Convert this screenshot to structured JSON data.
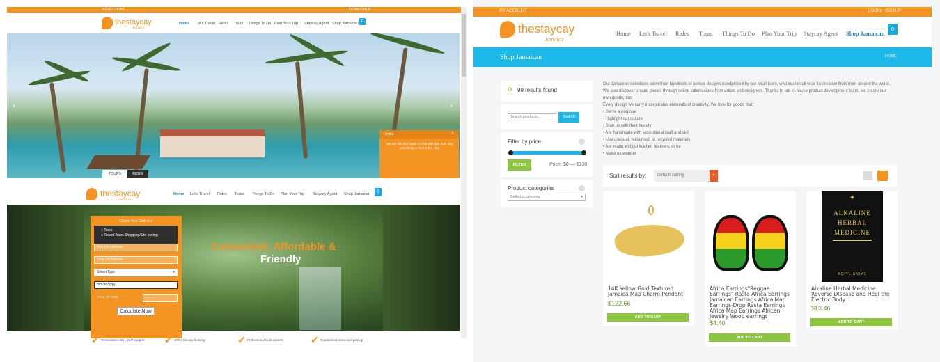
{
  "left_site": {
    "topbar": {
      "my_account": "MY ACCOUNT",
      "login": "LOGIN",
      "signup": "SIGNUP"
    },
    "logo": {
      "name": "thestaycay",
      "sub": "Jamaica"
    },
    "nav": [
      {
        "label": "Home"
      },
      {
        "label": "Let's Travel"
      },
      {
        "label": "Rides"
      },
      {
        "label": "Tours"
      },
      {
        "label": "Things To Do"
      },
      {
        "label": "Plan Your Trip"
      },
      {
        "label": "Staycay Agent"
      },
      {
        "label": "Shop Jamaican"
      }
    ],
    "cart_count": "0",
    "slider": {
      "prev": "‹",
      "next": "›",
      "tab1": "TOURS",
      "tab2": "RIDES"
    },
    "chat": {
      "title": "Online",
      "message": "We are live and ready to chat with you now. Say something to start a live chat."
    },
    "hero_title_line1": "Convenient, Affordable &",
    "hero_title_line2": "Friendly",
    "form": {
      "title": "Create Your Own tour",
      "radio1": "Tours",
      "radio2": "Round Tours Shopping/Site-seeing",
      "pickup_placeholder": "Pick Up Address",
      "dropoff_placeholder": "Drop Off Address",
      "select_type": "Select Type",
      "date_placeholder": "mm/dd/yyyy",
      "pickup_time_label": "PICK UP TIME",
      "time_value": "--:-- --",
      "calc_label": "Calculate Now"
    },
    "features": [
      "Reservation only - 24/7 support",
      "100% Secure Booking",
      "Professional local experts",
      "Guaranteed prices and pick up"
    ]
  },
  "right_site": {
    "topbar": {
      "my_account": "MY ACCOUNT",
      "login": "LOGIN",
      "signup": "SIGNUP"
    },
    "logo": {
      "name": "thestaycay",
      "sub": "Jamaica"
    },
    "nav": [
      {
        "label": "Home"
      },
      {
        "label": "Let's Travel"
      },
      {
        "label": "Rides"
      },
      {
        "label": "Tours"
      },
      {
        "label": "Things To Do"
      },
      {
        "label": "Plan Your Trip"
      },
      {
        "label": "Staycay Agent"
      },
      {
        "label": "Shop Jamaican"
      }
    ],
    "cart_count": "0",
    "page_title": "Shop Jamaican",
    "breadcrumb": "HOME",
    "results": "99 results found",
    "search_placeholder": "Search products…",
    "search_button": "Search",
    "filter_title": "Filter by price",
    "filter_button": "FILTER",
    "price_range": "Price: $0 — $130",
    "categories_title": "Product categories",
    "category_select": "Select a category",
    "description": [
      "Our Jamaican selections stem from hundreds of unique designs handpicked by our retail team, who search all year for creative finds from around the world.",
      "We also discover unique pieces through online submissions from artists and designers. Thanks to our in-house product development team, we create our",
      "own goods, too.",
      "Every design we carry incorporates elements of creativity. We look for goods that:",
      "• Serve a purpose",
      "• Highlight our culture",
      "• Stun us with their beauty",
      "• Are handmade with exceptional craft and skill",
      "• Use unusual, reclaimed, or recycled materials",
      "• Are made without leather, feathers, or fur",
      "• Make us wonder"
    ],
    "sort_label": "Sort results by:",
    "sort_value": "Default sorting",
    "products": [
      {
        "title": "14K Yellow Gold Textured Jamaica Map Charm Pendant",
        "price": "$122.66",
        "button": "ADD TO CART"
      },
      {
        "title": "Africa Earrings\"Reggae Earrings\" Rasta Africa Earrings Jamaican Earrings Africa Map Earrings-Drop Rasta Earrings Africa Map Earrings African Jewelry Wood earrings",
        "price": "$4.40",
        "button": "ADD TO CART"
      },
      {
        "title": "Alkaline Herbal Medicine: Reverse Disease and Heal the Electric Body",
        "price": "$13.46",
        "button": "ADD TO CART"
      }
    ],
    "book": {
      "line1": "Alkaline",
      "line2": "Herbal",
      "line3": "Medicine",
      "author": "Aqiyl Aniys"
    },
    "colors": {
      "orange": "#f39322",
      "blue": "#1bb8e8",
      "green": "#8cc53f"
    }
  }
}
